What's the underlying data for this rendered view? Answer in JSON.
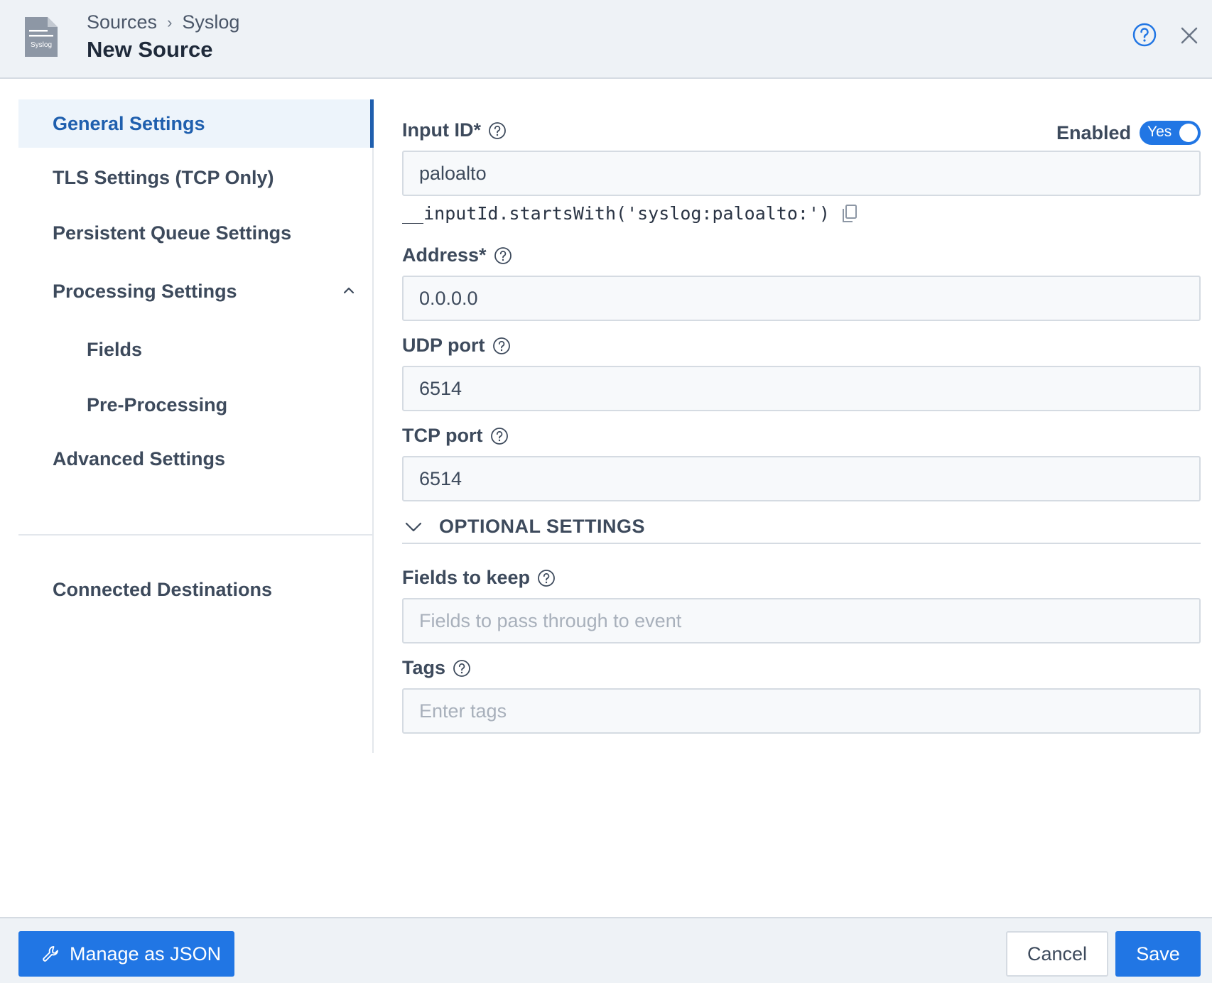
{
  "header": {
    "breadcrumb": [
      "Sources",
      "Syslog"
    ],
    "breadcrumb_separator": "›",
    "title": "New Source",
    "file_icon_label": "Syslog",
    "icons": {
      "help": "help-circle-icon",
      "close": "close-icon",
      "file": "file-document-icon"
    }
  },
  "sidebar": {
    "items": [
      {
        "label": "General Settings",
        "active": true
      },
      {
        "label": "TLS Settings (TCP Only)",
        "active": false
      },
      {
        "label": "Persistent Queue Settings",
        "active": false
      },
      {
        "label": "Processing Settings",
        "active": false,
        "expanded": true
      },
      {
        "label": "Fields",
        "active": false,
        "sub": true
      },
      {
        "label": "Pre-Processing",
        "active": false,
        "sub": true
      },
      {
        "label": "Advanced Settings",
        "active": false
      },
      {
        "label": "Connected Destinations",
        "active": false
      }
    ]
  },
  "form": {
    "enabled": {
      "label": "Enabled",
      "toggle_text": "Yes",
      "on": true
    },
    "input_id": {
      "label": "Input ID*",
      "value": "paloalto"
    },
    "filter_expression": "__inputId.startsWith('syslog:paloalto:')",
    "address": {
      "label": "Address*",
      "value": "0.0.0.0"
    },
    "udp_port": {
      "label": "UDP port",
      "value": "6514"
    },
    "tcp_port": {
      "label": "TCP port",
      "value": "6514"
    },
    "optional_settings": {
      "label": "OPTIONAL SETTINGS",
      "expanded": true
    },
    "fields_to_keep": {
      "label": "Fields to keep",
      "placeholder": "Fields to pass through to event"
    },
    "tags": {
      "label": "Tags",
      "placeholder": "Enter tags"
    }
  },
  "footer": {
    "manage_json_label": "Manage as JSON",
    "cancel_label": "Cancel",
    "save_label": "Save"
  },
  "colors": {
    "accent": "#2176e4",
    "active_nav_text": "#1f5fae",
    "active_nav_bg": "#edf4fb",
    "header_bg": "#eef2f6"
  }
}
